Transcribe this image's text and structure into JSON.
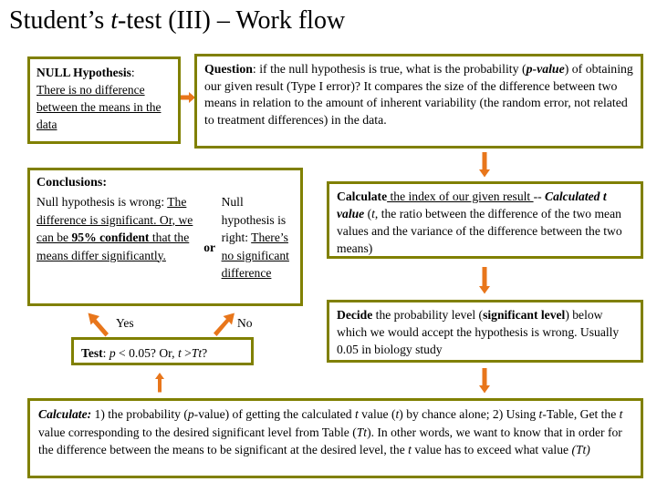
{
  "slide": {
    "title_parts": {
      "before": "Student’s ",
      "italic": "t",
      "after": "-test (III) – Work flow"
    },
    "title_full": "Student’s t-test (III) – Work flow"
  },
  "colors": {
    "box_border": "#808000",
    "arrow": "#E8761B",
    "background": "#FFFFFF",
    "text": "#000000"
  },
  "null_box": {
    "heading": "NULL Hypothesis",
    "heading_colon": ":",
    "body": "There is no difference between the means in the data"
  },
  "question_box": {
    "heading": "Question",
    "heading_colon": ":",
    "text_1": " if the null hypothesis is true, what is the probability (",
    "emphasis_1": "p-value",
    "text_2": ") of obtaining our given result (Type I error)? It compares the size of the difference between two means in relation to the amount of inherent variability (the random error, not related to treatment differences) in the data."
  },
  "conclusions_box": {
    "heading": "Conclusions:",
    "left_lead": "Null hypothesis is wrong:",
    "left_underline_1": "The difference is significant. Or, we can be ",
    "left_bold_underline": "95% confident",
    "left_underline_2": " that the means differ significantly.",
    "connector": "or",
    "right_lead": "Null hypothesis is right:",
    "right_underline": "There’s no significant difference"
  },
  "calc_box": {
    "bold_lead": "Calculate",
    "underlined": " the index of our given result ",
    "dashes": "--",
    "bold_italic": "Calculated t value",
    "text_open": " (",
    "italic_t": "t",
    "text_rest": ", the ratio between the difference of the two mean values and the variance of the difference between the two means)"
  },
  "decide_box": {
    "bold_lead": "Decide",
    "text_1": " the probability level (",
    "bold_2": "significant level",
    "text_2": ") below which we would accept the hypothesis is wrong. Usually 0.05 in biology study"
  },
  "test_box": {
    "bold_lead": "Test",
    "colon": ": ",
    "italic_p": "p",
    "mid": " < 0.05? Or, ",
    "italic_t": "t",
    "gt": " >",
    "italic_tt": "Tt",
    "end": "?"
  },
  "branch_labels": {
    "yes": "Yes",
    "no": "No"
  },
  "bottom_box": {
    "bold_italic_lead": "Calculate:",
    "seg_1": " 1) the probability (",
    "italic_p": "p",
    "seg_2": "-value) of getting the calculated ",
    "italic_t1": "t",
    "seg_3": " value (",
    "italic_t2": "t",
    "seg_4": ") by chance alone; 2) Using ",
    "italic_t3": "t",
    "seg_5": "-Table, Get the ",
    "italic_t4": "t",
    "seg_6": " value corresponding to the desired significant level from Table (",
    "italic_tt1": "Tt",
    "seg_7": ").  In other words, we want to know that in order for the difference between the means to be significant at the desired level, the ",
    "italic_t5": "t",
    "seg_8": " value has to exceed what value ",
    "italic_tt2": "(Tt)"
  },
  "arrows": [
    {
      "name": "arrow-null-to-question",
      "direction": "right"
    },
    {
      "name": "arrow-question-to-calculate",
      "direction": "down"
    },
    {
      "name": "arrow-calculate-to-decide",
      "direction": "down"
    },
    {
      "name": "arrow-decide-to-bottom",
      "direction": "down"
    },
    {
      "name": "arrow-bottom-to-test",
      "direction": "up"
    },
    {
      "name": "arrow-yes-branch",
      "direction": "up-left"
    },
    {
      "name": "arrow-no-branch",
      "direction": "up-right"
    }
  ]
}
